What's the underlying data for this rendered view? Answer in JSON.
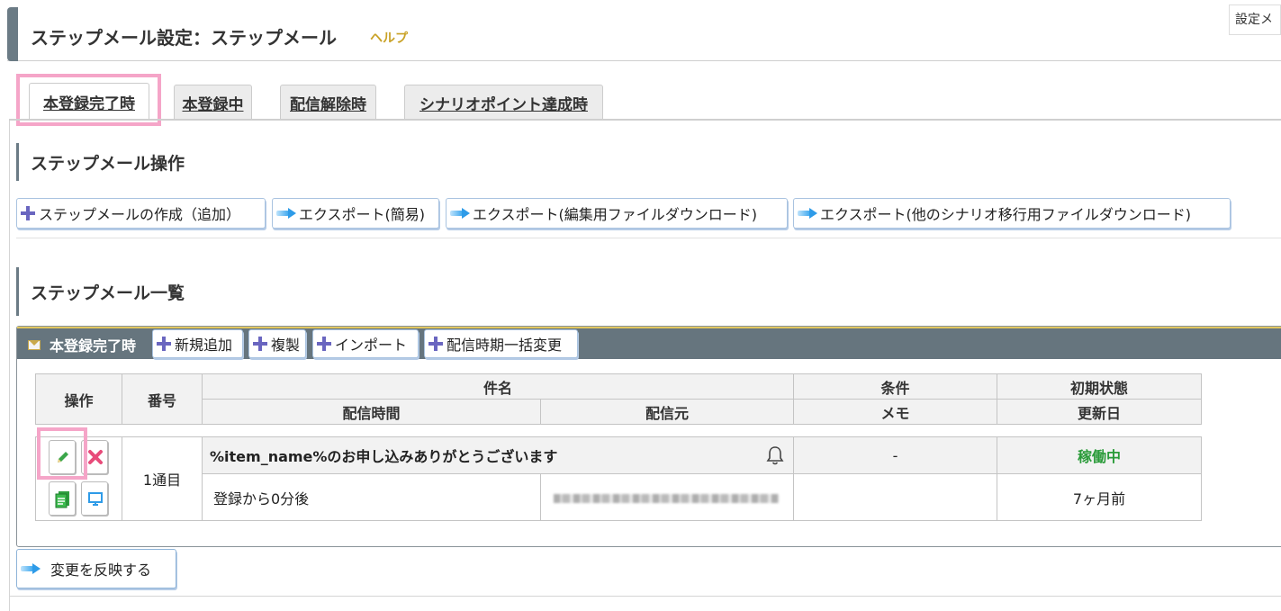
{
  "header": {
    "title": "ステップメール設定：ステップメール",
    "help": "ヘルプ",
    "top_right": "設定メ"
  },
  "tabs": [
    {
      "label": "本登録完了時",
      "active": true
    },
    {
      "label": "本登録中"
    },
    {
      "label": "配信解除時"
    },
    {
      "label": "シナリオポイント達成時"
    }
  ],
  "operations": {
    "heading": "ステップメール操作",
    "buttons": {
      "create": "ステップメールの作成（追加）",
      "export_simple": "エクスポート(簡易)",
      "export_edit": "エクスポート(編集用ファイルダウンロード)",
      "export_other": "エクスポート(他のシナリオ移行用ファイルダウンロード)"
    }
  },
  "list": {
    "heading": "ステップメール一覧",
    "panel_title": "本登録完了時",
    "panel_buttons": {
      "add": "新規追加",
      "copy": "複製",
      "import": "インポート",
      "bulk_change": "配信時期一括変更"
    },
    "table": {
      "headers": {
        "ops": "操作",
        "number": "番号",
        "subject": "件名",
        "condition": "条件",
        "initial_state": "初期状態",
        "delivery_time": "配信時間",
        "sender": "配信元",
        "memo": "メモ",
        "updated": "更新日"
      },
      "rows": [
        {
          "number": "1通目",
          "subject": "%item_name%のお申し込みありがとうございます",
          "condition": "-",
          "status": "稼働中",
          "delivery_time": "登録から0分後",
          "updated": "7ヶ月前"
        }
      ]
    }
  },
  "apply_button": "変更を反映する",
  "colors": {
    "accent_bar": "#6b7b85",
    "help": "#c9a227",
    "status_active": "#2a9b39",
    "highlight": "#f5a5c8",
    "plus_icon": "#6a66c0"
  }
}
